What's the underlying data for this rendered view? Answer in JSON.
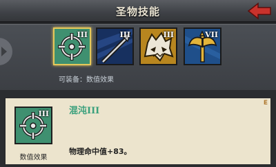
{
  "header": {
    "title": "圣物技能"
  },
  "skills": [
    {
      "level": "III",
      "icon": "crosshair-icon",
      "color": "#3f9070"
    },
    {
      "level": "III",
      "icon": "arrow-icon",
      "color": "#1f3d78"
    },
    {
      "level": "III",
      "icon": "wolf-head-icon",
      "color": "#b8861f"
    },
    {
      "level": "VII",
      "icon": "axe-icon",
      "color": "#1f4f8a"
    }
  ],
  "equip_label": "可装备：数值效果",
  "detail": {
    "name": "混沌III",
    "level": "III",
    "type_label": "数值效果",
    "description": "物理命中值+83。",
    "corner": "E"
  },
  "colors": {
    "gold": "#e6c85a",
    "accent_red": "#c8322c",
    "name_green": "#3aa07c"
  }
}
